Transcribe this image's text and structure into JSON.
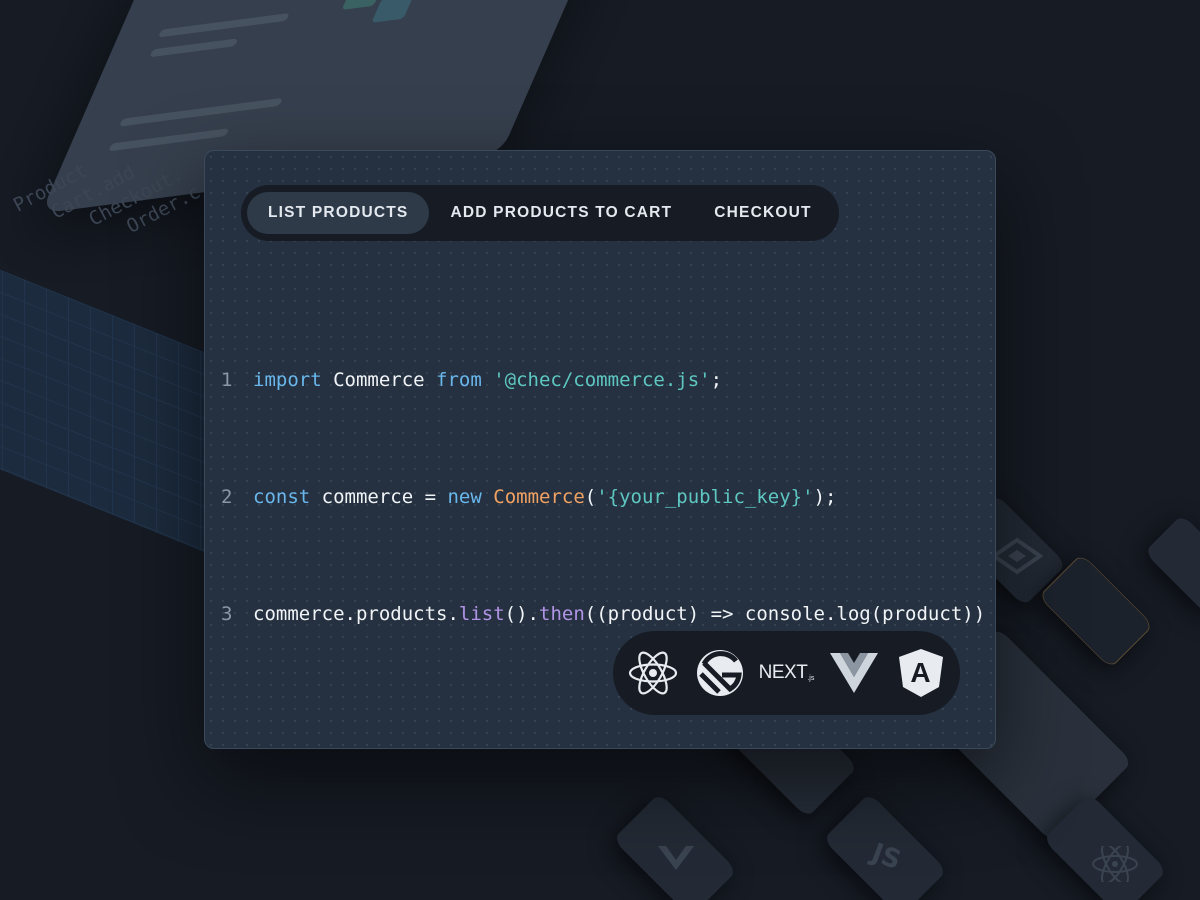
{
  "background": {
    "code_lines": [
      "Product",
      "Cart.add",
      "Checkout.",
      "Order.c"
    ],
    "tile_label": "JS"
  },
  "tabs": [
    {
      "label": "LIST PRODUCTS",
      "active": true
    },
    {
      "label": "ADD PRODUCTS TO CART",
      "active": false
    },
    {
      "label": "CHECKOUT",
      "active": false
    }
  ],
  "code": {
    "line_numbers": [
      "1",
      "2",
      "3"
    ],
    "line1": {
      "kw1": "import",
      "name": " Commerce ",
      "kw2": "from",
      "str": " '@chec/commerce.js'",
      "end": ";"
    },
    "line2": {
      "kw1": "const",
      "name": " commerce = ",
      "kw2": "new",
      "cls": " Commerce",
      "p1": "(",
      "str": "'{your_public_key}'",
      "end": ");"
    },
    "line3": {
      "obj": "commerce.products.",
      "fn1": "list",
      "p1": "().",
      "fn2": "then",
      "rest": "((product) => console.log(product))"
    }
  },
  "frameworks": [
    {
      "name": "react-icon"
    },
    {
      "name": "gatsby-icon"
    },
    {
      "name": "nextjs-icon",
      "label": "NEXT",
      "sub": ".js"
    },
    {
      "name": "vue-icon"
    },
    {
      "name": "angular-icon",
      "label": "A"
    }
  ],
  "colors": {
    "keyword": "#69b7ec",
    "string": "#5ec7c1",
    "class": "#f1a262",
    "function": "#b294e6",
    "panel": "#253140",
    "background": "#161b24"
  }
}
